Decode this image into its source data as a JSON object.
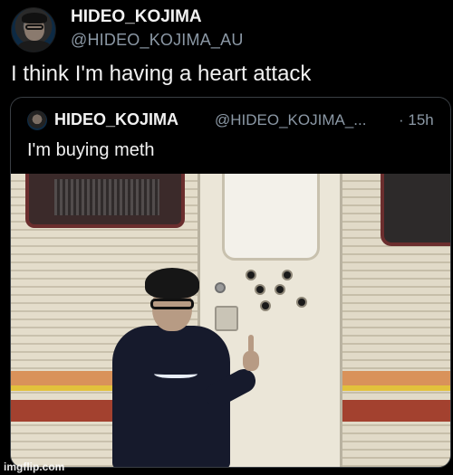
{
  "tweet": {
    "author_name": "HIDEO_KOJIMA",
    "author_handle": "@HIDEO_KOJIMA_AU",
    "text": "I think I'm having a heart attack"
  },
  "quoted_tweet": {
    "author_name": "HIDEO_KOJIMA",
    "author_handle": "@HIDEO_KOJIMA_...",
    "time": "· 15h",
    "text": "I'm buying meth"
  },
  "watermark": "imgflip.com",
  "icons": [
    "avatar",
    "photo"
  ],
  "colors": {
    "background": "#000000",
    "text": "#e7e9ea",
    "secondary_text": "#8b98a5",
    "quote_border": "#3a3f44"
  }
}
